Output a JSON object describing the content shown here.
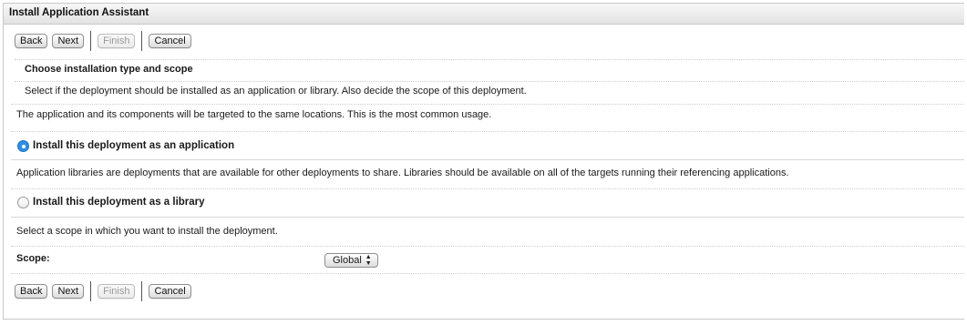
{
  "window": {
    "title": "Install Application Assistant"
  },
  "toolbar": {
    "back": "Back",
    "next": "Next",
    "finish": "Finish",
    "cancel": "Cancel"
  },
  "section": {
    "heading": "Choose installation type and scope",
    "description": "Select if the deployment should be installed as an application or library. Also decide the scope of this deployment."
  },
  "application_option": {
    "description": "The application and its components will be targeted to the same locations. This is the most common usage.",
    "label": "Install this deployment as an application",
    "selected": true
  },
  "library_option": {
    "description": "Application libraries are deployments that are available for other deployments to share. Libraries should be available on all of the targets running their referencing applications.",
    "label": "Install this deployment as a library",
    "selected": false
  },
  "scope": {
    "description": "Select a scope in which you want to install the deployment.",
    "label": "Scope:",
    "value": "Global"
  },
  "colors": {
    "accent": "#2f8ee3"
  }
}
